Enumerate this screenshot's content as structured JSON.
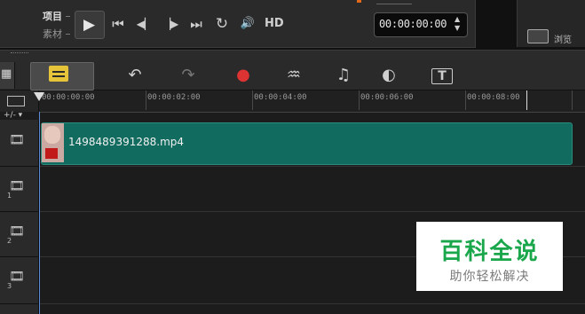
{
  "player": {
    "mode_project": "项目",
    "mode_clip": "素材",
    "hd_label": "HD",
    "timecode": "00:00:00:00",
    "browse_label": "浏览"
  },
  "controls": {
    "play": "▶",
    "to_start": "⏮",
    "prev_frame": "◀▏",
    "next_frame": "▕▶",
    "to_end": "⏭",
    "repeat": "↻",
    "volume": "🔊",
    "spin_up": "▲",
    "spin_down": "▼"
  },
  "toolbar_icons": {
    "storyboard": "▦",
    "undo": "↶",
    "redo": "↷",
    "record_capture": "●",
    "sound_mixer": "♒",
    "auto_music": "♫",
    "motion_tracking": "◐",
    "subtitle_editor": "T"
  },
  "ruler": {
    "ticks": [
      "00:00:00:00",
      "00:00:02:00",
      "00:00:04:00",
      "00:00:06:00",
      "00:00:08:00"
    ],
    "track_manager": "+/- ▾"
  },
  "tracks": [
    {
      "number": ""
    },
    {
      "number": "1"
    },
    {
      "number": "2"
    },
    {
      "number": "3"
    }
  ],
  "clip": {
    "name": "1498489391288.mp4"
  },
  "watermark": {
    "title": "百科全说",
    "subtitle": "助你轻松解决"
  },
  "colors": {
    "clip_fill": "#116b5e",
    "watermark_green": "#1aa64b",
    "timeline_glyph": "#e6c43a",
    "playhead": "#5a8ad6"
  }
}
